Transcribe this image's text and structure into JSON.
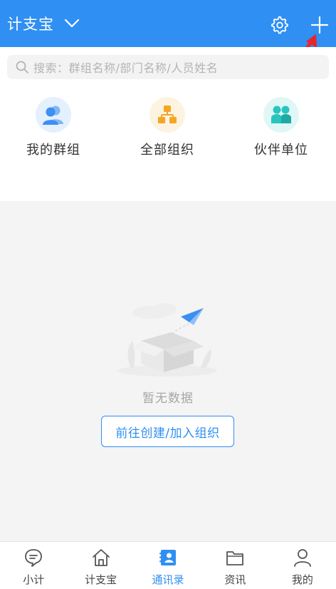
{
  "header": {
    "org_title": "计支宝",
    "icons": {
      "switch": "chevron-down-icon",
      "settings": "gear-icon",
      "add": "plus-icon"
    },
    "colors": {
      "background": "#2f8ff2",
      "annotation_arrow": "#e8252b"
    }
  },
  "search": {
    "placeholder": "搜索：群组名称/部门名称/人员姓名"
  },
  "quick_actions": [
    {
      "label": "我的群组",
      "icon": "group-icon",
      "color": "#3d8ff0"
    },
    {
      "label": "全部组织",
      "icon": "org-chart-icon",
      "color": "#f5a623"
    },
    {
      "label": "伙伴单位",
      "icon": "partner-icon",
      "color": "#28c4c0"
    }
  ],
  "empty_state": {
    "message": "暂无数据",
    "action_label": "前往创建/加入组织"
  },
  "bottom_nav": {
    "items": [
      {
        "label": "小计",
        "icon": "chat-bubble-icon"
      },
      {
        "label": "计支宝",
        "icon": "home-icon"
      },
      {
        "label": "通讯录",
        "icon": "contacts-icon",
        "active": true
      },
      {
        "label": "资讯",
        "icon": "folder-icon"
      },
      {
        "label": "我的",
        "icon": "person-icon"
      }
    ],
    "active_color": "#2f8ff2"
  }
}
